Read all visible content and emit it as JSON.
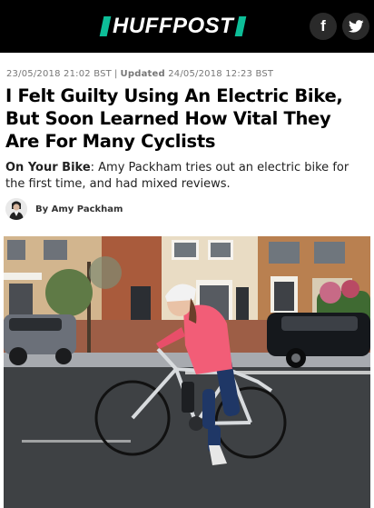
{
  "header": {
    "brand": "HUFFPOST",
    "brand_color": "#0DBE98",
    "social": [
      {
        "icon": "facebook-icon",
        "glyph": "f"
      },
      {
        "icon": "twitter-icon"
      }
    ]
  },
  "article": {
    "published": "23/05/2018 21:02 BST",
    "updated_label": "Updated",
    "updated": "24/05/2018 12:23 BST",
    "title": "I Felt Guilty Using An Electric Bike, But Soon Learned How Vital They Are For Many Cyclists",
    "kicker": "On Your Bike",
    "summary": ": Amy Packham tries out an electric bike for the first time, and had mixed reviews.",
    "byline": "By Amy Packham"
  }
}
